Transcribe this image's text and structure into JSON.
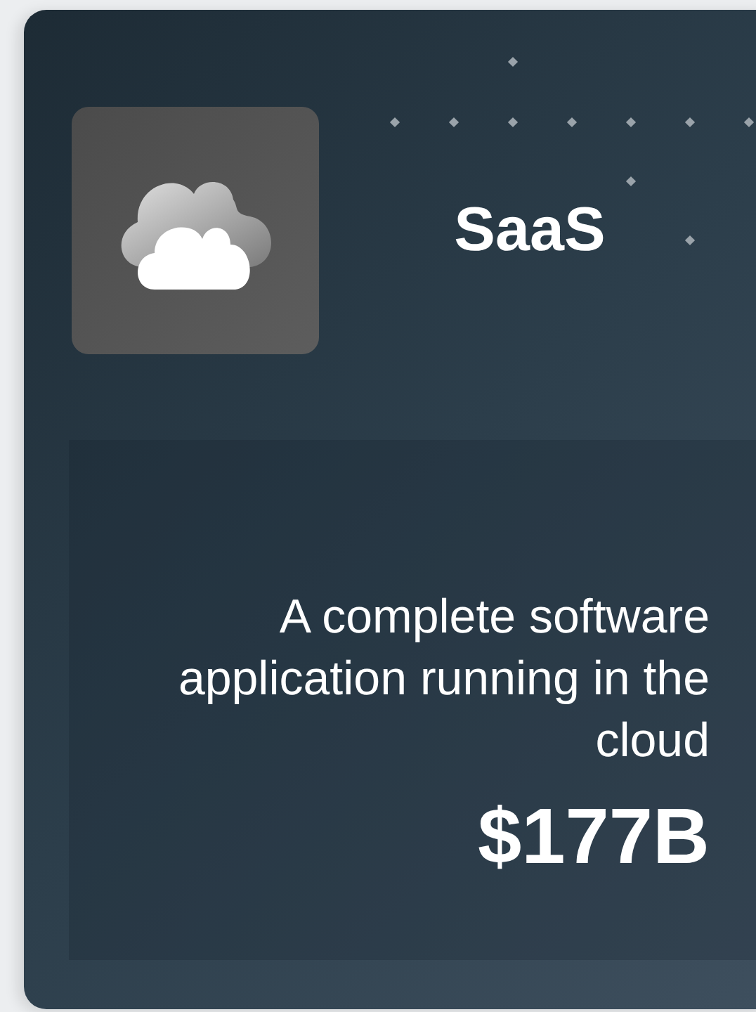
{
  "card": {
    "title": "SaaS",
    "description": "A complete software application running in the cloud",
    "value": "$177B"
  }
}
